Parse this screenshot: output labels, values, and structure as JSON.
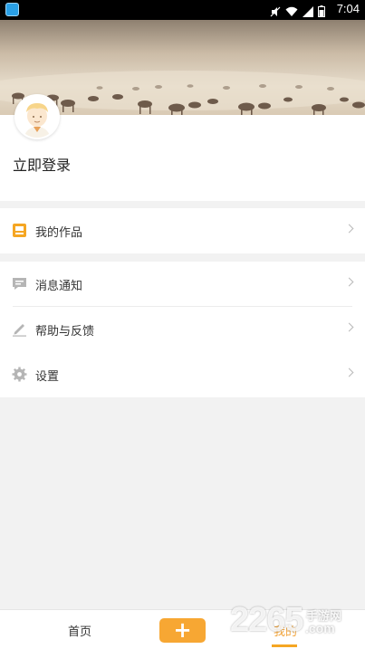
{
  "status_bar": {
    "time": "7:04"
  },
  "profile": {
    "login_label": "立即登录"
  },
  "menu": {
    "works": {
      "label": "我的作品",
      "icon": "works-icon"
    },
    "items": [
      {
        "label": "消息通知",
        "icon": "message-icon"
      },
      {
        "label": "帮助与反馈",
        "icon": "pencil-icon"
      },
      {
        "label": "设置",
        "icon": "gear-icon"
      }
    ]
  },
  "tabbar": {
    "home_label": "首页",
    "add_label": "+",
    "mine_label": "我的",
    "active_color": "#f5a623"
  },
  "watermark": {
    "number": "2265",
    "text": "手游网",
    "domain": ".com"
  },
  "colors": {
    "accent": "#f5a623",
    "background": "#f2f2f2"
  }
}
